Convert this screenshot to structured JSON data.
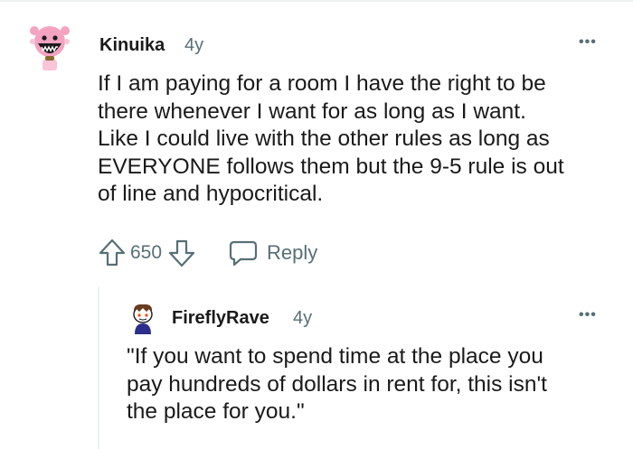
{
  "comment": {
    "username": "Kinuika",
    "age": "4y",
    "more_label": "•••",
    "body_lines": [
      "If I am paying for a room I have the right to be",
      "there whenever I want for as long as I want.",
      "Like I could live with the other rules as long as",
      "EVERYONE follows them but the 9-5 rule is out",
      "of line and hypocritical."
    ],
    "vote_count": "650",
    "reply_label": "Reply",
    "icons": [
      "upvote-icon",
      "downvote-icon",
      "reply-bubble-icon",
      "more-options-icon"
    ]
  },
  "reply": {
    "username": "FireflyRave",
    "age": "4y",
    "more_label": "•••",
    "body_lines": [
      "\"If you want to spend time at the place you",
      "pay hundreds of dollars in rent for, this isn't",
      "the place for you.\""
    ]
  },
  "colors": {
    "text": "#1a1a1b",
    "meta": "#576f76",
    "thread_line": "#edeff1",
    "avatar1_accent": "#f4a3c1",
    "avatar2_accent": "#2b2e8a"
  }
}
